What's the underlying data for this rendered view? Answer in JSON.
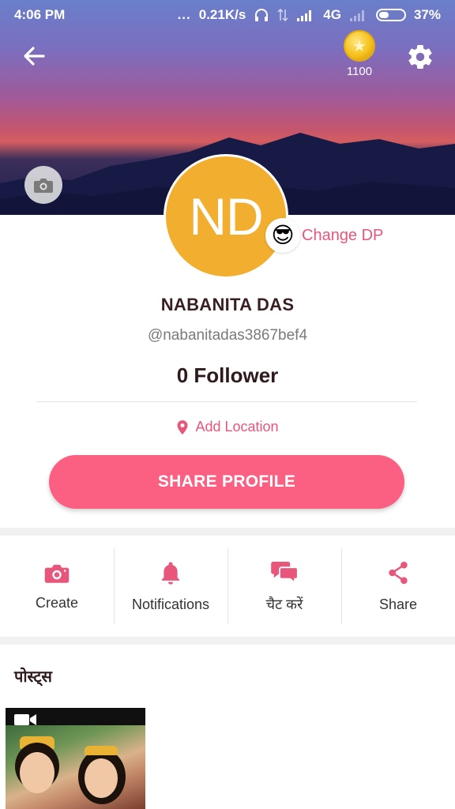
{
  "status_bar": {
    "time": "4:06 PM",
    "dots": "...",
    "speed": "0.21K/s",
    "network": "4G",
    "battery": "37%"
  },
  "header": {
    "coin_count": "1100",
    "icons": [
      "back-arrow-icon",
      "coin-icon",
      "gear-icon",
      "camera-icon"
    ]
  },
  "profile": {
    "initials": "ND",
    "avatar_color": "#f2ae2e",
    "change_dp_label": "Change DP",
    "emoji": "😎",
    "name": "NABANITA DAS",
    "handle": "@nabanitadas3867bef4",
    "followers": "0 Follower",
    "add_location_label": "Add Location",
    "share_profile_label": "SHARE PROFILE",
    "accent_color": "#fb5f82"
  },
  "actions": [
    {
      "label": "Create",
      "icon": "camera-icon"
    },
    {
      "label": "Notifications",
      "icon": "bell-icon"
    },
    {
      "label": "चैट करें",
      "icon": "chat-icon"
    },
    {
      "label": "Share",
      "icon": "share-icon"
    }
  ],
  "posts": {
    "title": "पोस्ट्स",
    "items": [
      {
        "type": "video",
        "icon": "video-camera-icon"
      }
    ]
  }
}
